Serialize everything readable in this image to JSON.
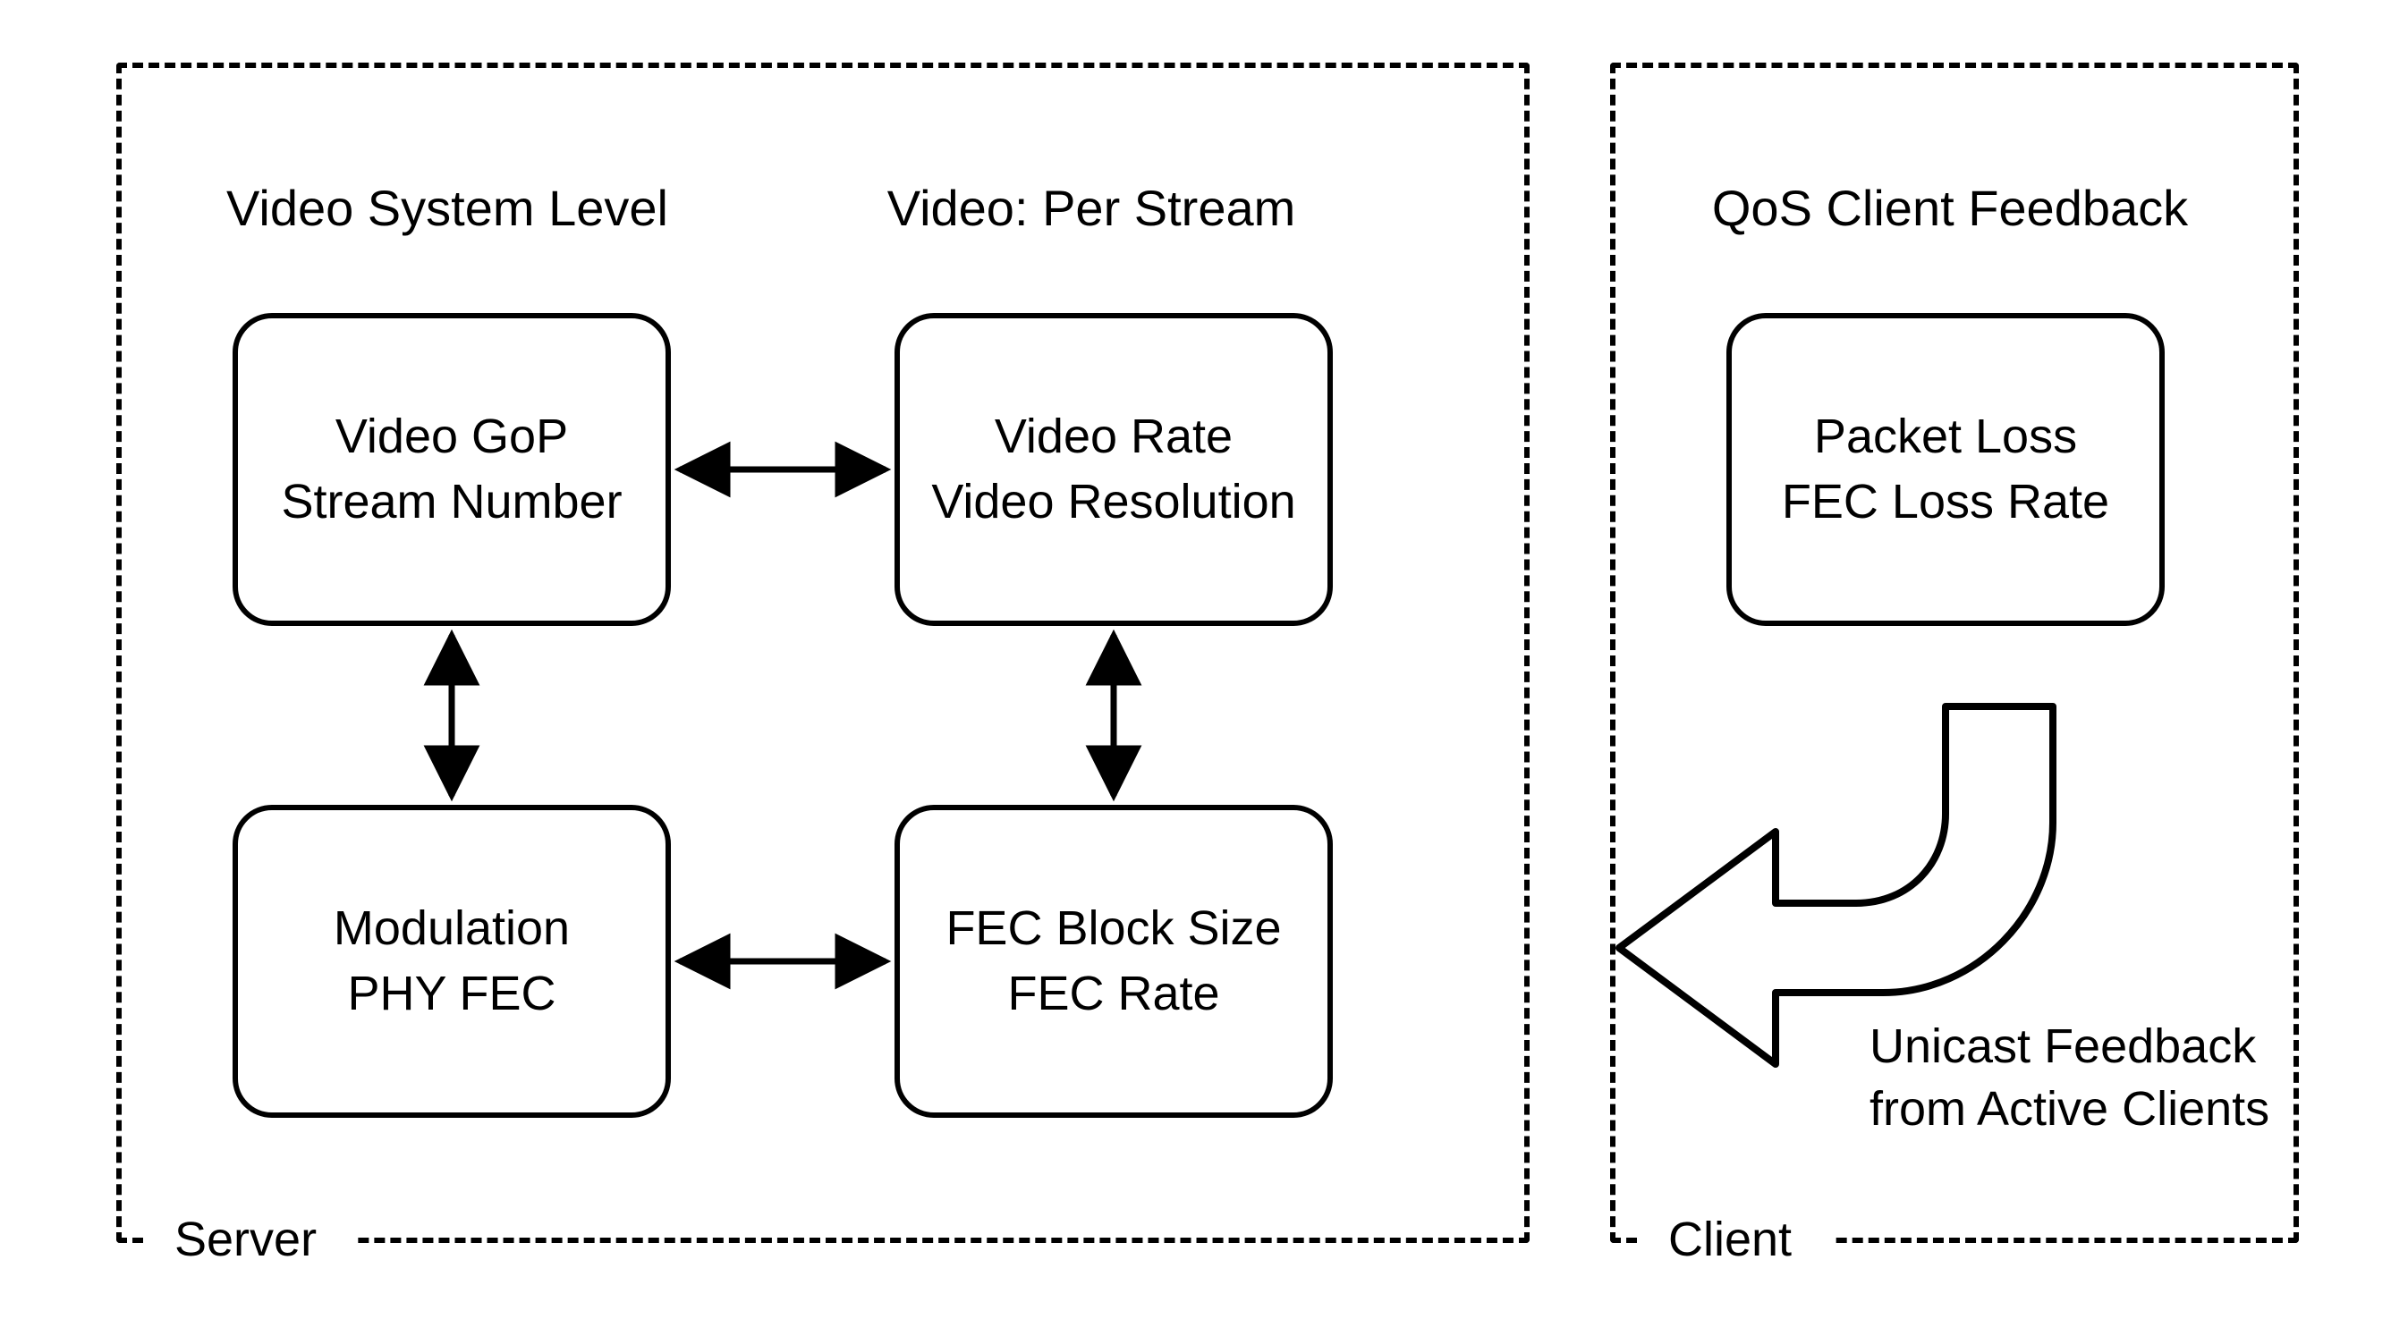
{
  "server": {
    "panel_label": "Server",
    "titles": {
      "left": "Video System Level",
      "right": "Video: Per Stream"
    },
    "nodes": {
      "top_left": {
        "line1": "Video GoP",
        "line2": "Stream Number"
      },
      "top_right": {
        "line1": "Video Rate",
        "line2": "Video Resolution"
      },
      "bottom_left": {
        "line1": "Modulation",
        "line2": "PHY FEC"
      },
      "bottom_right": {
        "line1": "FEC Block Size",
        "line2": "FEC Rate"
      }
    }
  },
  "client": {
    "panel_label": "Client",
    "title": "QoS Client Feedback",
    "node": {
      "line1": "Packet Loss",
      "line2": "FEC Loss Rate"
    },
    "arrow_caption": {
      "line1": "Unicast Feedback",
      "line2": "from Active Clients"
    }
  }
}
